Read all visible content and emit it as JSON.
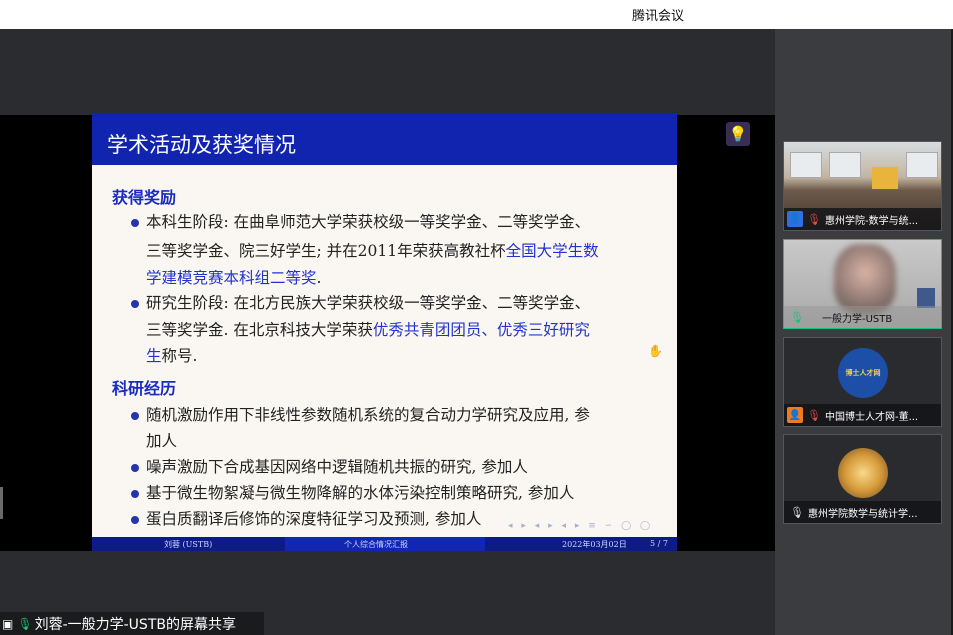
{
  "app": {
    "title": "腾讯会议"
  },
  "slide": {
    "title": "学术活动及获奖情况",
    "section1": "获得奖励",
    "item1": {
      "line1": "本科生阶段: 在曲阜师范大学荣获校级一等奖学金、二等奖学金、",
      "line2_a": "三等奖学金、院三好学生; 并在2011年荣获高教社杯",
      "line2_b": "全国大学生数",
      "line3_a": "学建模竞赛本科组二等奖",
      "line3_b": "."
    },
    "item2": {
      "line1": "研究生阶段: 在北方民族大学荣获校级一等奖学金、二等奖学金、",
      "line2_a": "三等奖学金. 在北京科技大学荣获",
      "line2_b": "优秀共青团团员、优秀三好研究",
      "line3_a": "生",
      "line3_b": "称号."
    },
    "section2": "科研经历",
    "items2": [
      {
        "line1": "随机激励作用下非线性参数随机系统的复合动力学研究及应用, 参",
        "line2": "加人"
      },
      {
        "line1": "噪声激励下合成基因网络中逻辑随机共振的研究, 参加人"
      },
      {
        "line1": "基于微生物絮凝与微生物降解的水体污染控制策略研究, 参加人"
      },
      {
        "line1": "蛋白质翻译后修饰的深度特征学习及预测, 参加人"
      }
    ],
    "footer": {
      "author": "刘蓉 (USTB)",
      "title": "个人综合情况汇报",
      "date": "2022年03月02日",
      "page": "5 / 7"
    }
  },
  "participants": [
    {
      "name": "惠州学院-数学与统...",
      "avatar_color": "#2f6fe0",
      "muted": true
    },
    {
      "name": "一般力学-USTB",
      "avatar_color": "",
      "muted": false,
      "active": true
    },
    {
      "name": "中国博士人才网-董...",
      "avatar_color": "#ef7b1e",
      "muted": true,
      "logo_text": "博士人才网"
    },
    {
      "name": "惠州学院数学与统计学...",
      "avatar_color": "",
      "muted": false
    }
  ],
  "share_label": "刘蓉-一般力学-USTB的屏幕共享",
  "icons": {
    "bulb": "lightbulb-icon",
    "mic": "microphone-icon",
    "user": "user-icon",
    "share": "screen-share-icon"
  }
}
